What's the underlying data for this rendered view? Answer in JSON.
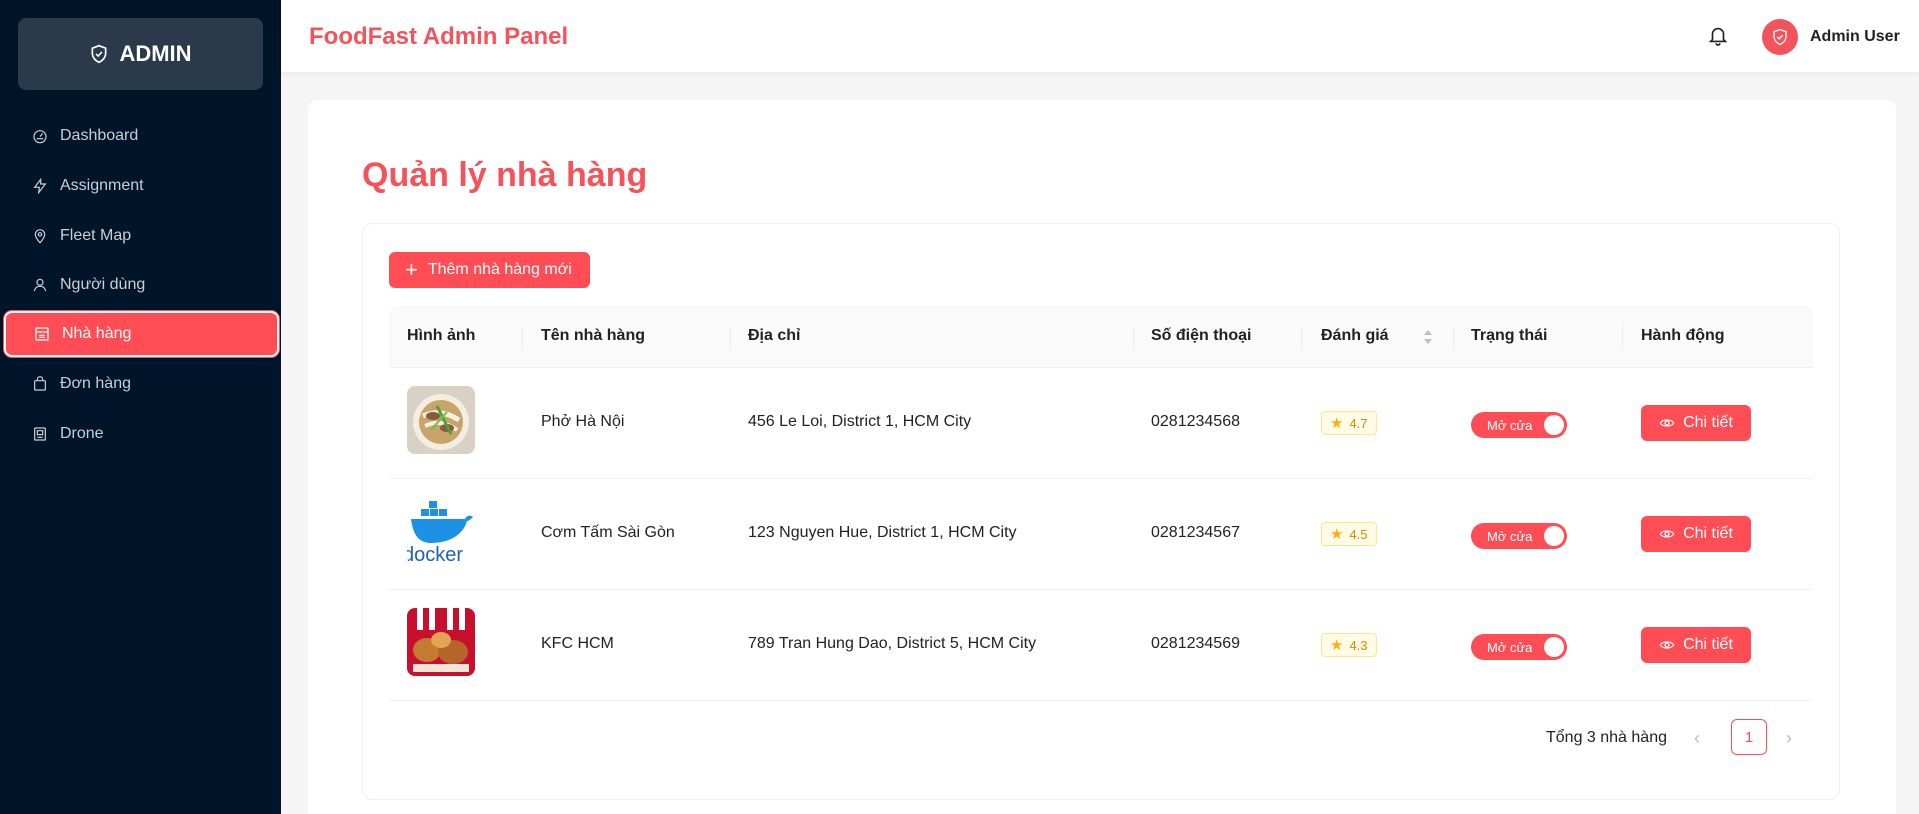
{
  "sidebar": {
    "brand": "ADMIN",
    "items": [
      {
        "label": "Dashboard",
        "icon": "dashboard-icon"
      },
      {
        "label": "Assignment",
        "icon": "lightning-icon"
      },
      {
        "label": "Fleet Map",
        "icon": "map-pin-icon"
      },
      {
        "label": "Người dùng",
        "icon": "user-icon"
      },
      {
        "label": "Nhà hàng",
        "icon": "shop-icon",
        "active": true
      },
      {
        "label": "Đơn hàng",
        "icon": "bag-icon"
      },
      {
        "label": "Drone",
        "icon": "drone-icon"
      }
    ]
  },
  "header": {
    "title": "FoodFast Admin Panel",
    "user_name": "Admin User"
  },
  "main": {
    "page_title": "Quản lý nhà hàng",
    "add_button": "Thêm nhà hàng mới",
    "columns": [
      "Hình ảnh",
      "Tên nhà hàng",
      "Địa chỉ",
      "Số điện thoại",
      "Đánh giá",
      "Trạng thái",
      "Hành động"
    ],
    "rows": [
      {
        "name": "Phở Hà Nội",
        "address": "456 Le Loi, District 1, HCM City",
        "phone": "0281234568",
        "rating": "4.7",
        "status": "Mở cửa",
        "action": "Chi tiết"
      },
      {
        "name": "Cơm Tấm Sài Gòn",
        "address": "123 Nguyen Hue, District 1, HCM City",
        "phone": "0281234567",
        "rating": "4.5",
        "status": "Mở cửa",
        "action": "Chi tiết"
      },
      {
        "name": "KFC HCM",
        "address": "789 Tran Hung Dao, District 5, HCM City",
        "phone": "0281234569",
        "rating": "4.3",
        "status": "Mở cửa",
        "action": "Chi tiết"
      }
    ],
    "pagination": {
      "total": "Tổng 3 nhà hàng",
      "current": "1"
    }
  },
  "colors": {
    "accent": "#ff4d55",
    "sidebar_bg": "#001529"
  }
}
